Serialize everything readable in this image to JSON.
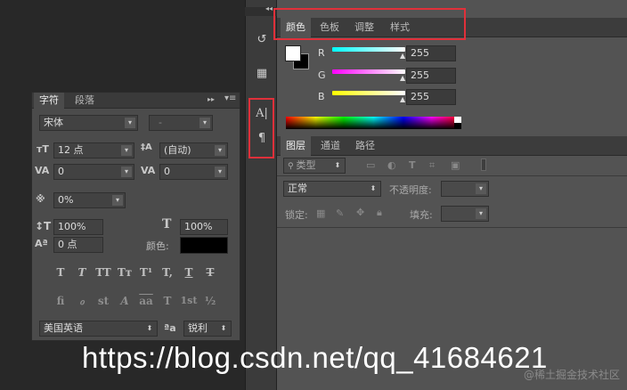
{
  "color_panel": {
    "tabs": [
      "颜色",
      "色板",
      "调整",
      "样式"
    ],
    "channels": [
      {
        "label": "R",
        "value": "255"
      },
      {
        "label": "G",
        "value": "255"
      },
      {
        "label": "B",
        "value": "255"
      }
    ],
    "foreground": "#ffffff",
    "background": "#000000"
  },
  "layers_panel": {
    "tabs": [
      "图层",
      "通道",
      "路径"
    ],
    "filter_kind": "类型",
    "blend_mode": "正常",
    "opacity_label": "不透明度:",
    "lock_label": "锁定:",
    "fill_label": "填充:"
  },
  "char_panel": {
    "tabs": [
      "字符",
      "段落"
    ],
    "font_family": "宋体",
    "font_style": "-",
    "font_size": "12 点",
    "leading": "(自动)",
    "kerning": "0",
    "tracking": "0",
    "scale_tsume": "0%",
    "vertical_scale": "100%",
    "horizontal_scale": "100%",
    "baseline_shift": "0 点",
    "color_label": "颜色:",
    "color_value": "#000000",
    "style_buttons": [
      "T",
      "T",
      "TT",
      "Tт",
      "T¹",
      "T,",
      "T",
      "T"
    ],
    "opentype_buttons": [
      "fi",
      "ℴ",
      "st",
      "A",
      "aa",
      "T",
      "1st",
      "½"
    ],
    "language": "美国英语",
    "aa_label": "ªa",
    "antialias": "锐利"
  },
  "watermark": "https://blog.csdn.net/qq_41684621",
  "corner_watermark": "@稀土掘金技术社区"
}
